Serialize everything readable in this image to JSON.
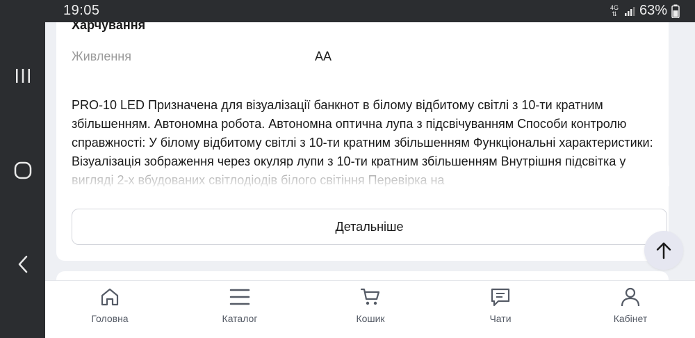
{
  "status_bar": {
    "time": "19:05",
    "network_label": "4G",
    "battery": "63%"
  },
  "product": {
    "section_heading": "Харчування",
    "spec_key": "Живлення",
    "spec_value": "AA",
    "description": "PRO-10 LED Призначена для візуалізації банкнот в білому відбитому світлі з 10-ти кратним збільшенням. Автономна робота. Автономна оптична лупа з підсвічуванням Способи контролю справжності: У білому відбитому світлі з 10-ти кратним збільшенням Функціональні характеристики: Візуалізація зображення через окуляр лупи з 10-ти кратним збільшенням Внутрішня підсвітка у вигляді 2-х вбудованих світлодіодів білого світіння Перевірка на",
    "more_button": "Детальніше"
  },
  "tabs": [
    {
      "label": "Головна",
      "icon": "home-icon"
    },
    {
      "label": "Каталог",
      "icon": "menu-icon"
    },
    {
      "label": "Кошик",
      "icon": "cart-icon"
    },
    {
      "label": "Чати",
      "icon": "chat-icon"
    },
    {
      "label": "Кабінет",
      "icon": "user-icon"
    }
  ],
  "colors": {
    "background": "#eef0f4",
    "card": "#ffffff",
    "muted_text": "#9a9a9a",
    "tab_icon": "#555b66"
  }
}
